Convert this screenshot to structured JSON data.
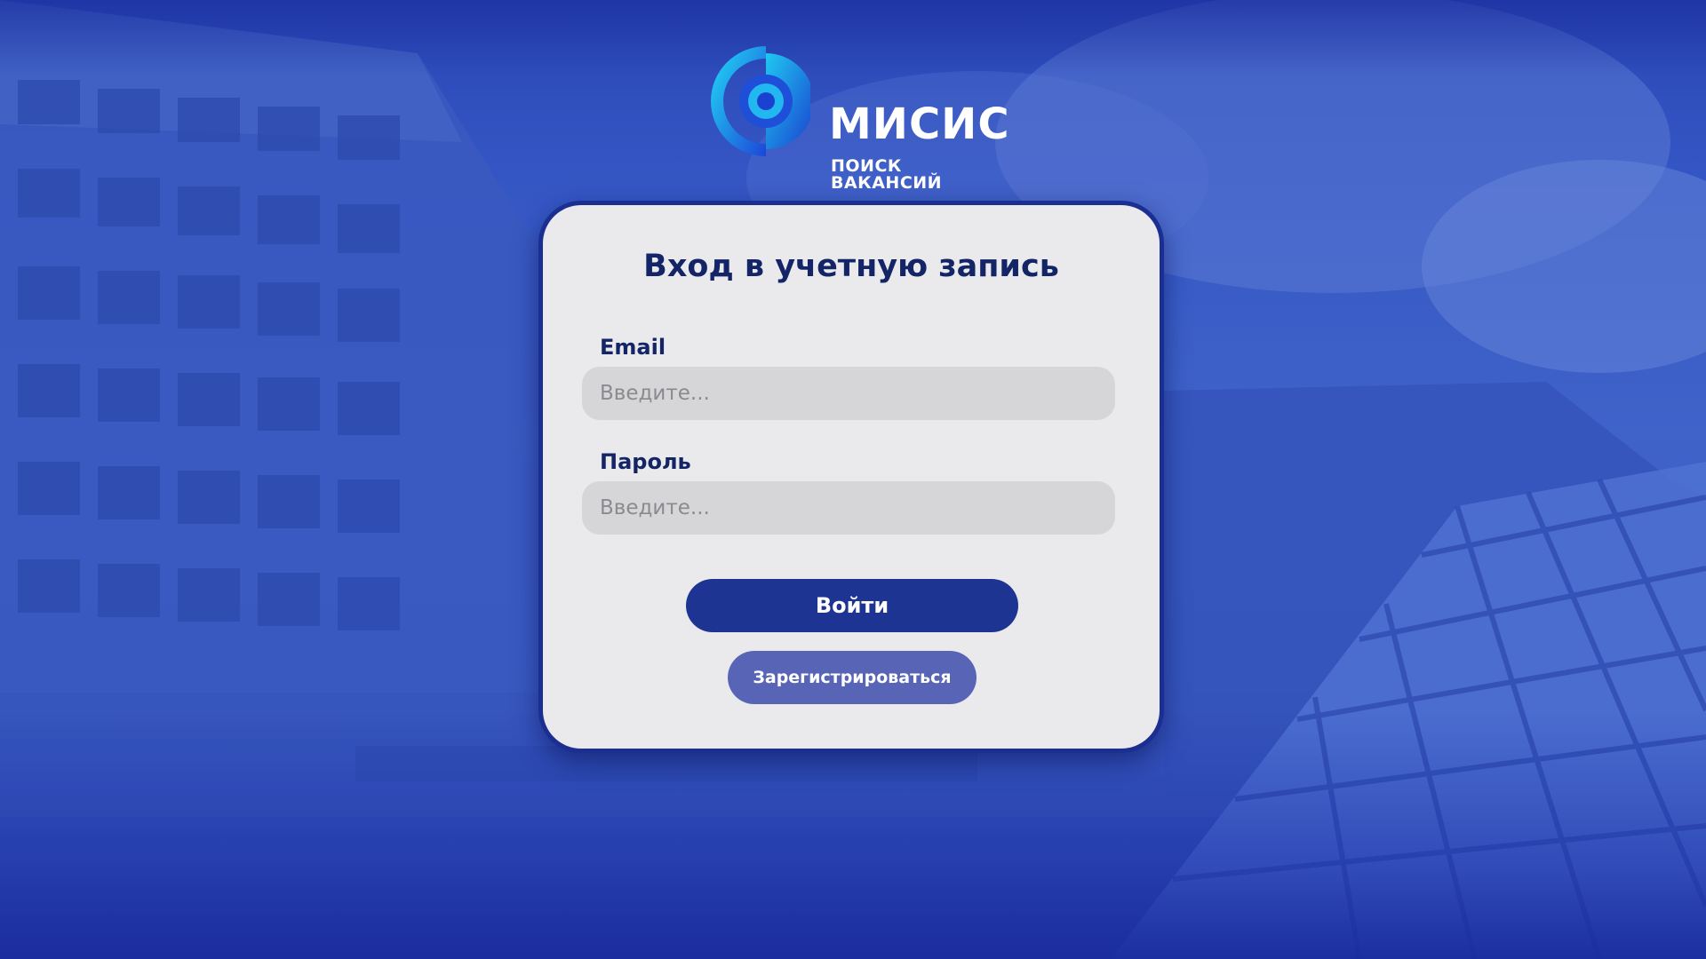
{
  "brand": {
    "name": "МИСИС",
    "tagline": "ПОИСК ВАКАНСИЙ",
    "logo_icon": "misis-logo-icon",
    "colors": {
      "logo_gradient_start": "#1ed2f5",
      "logo_gradient_end": "#1f4ad8"
    }
  },
  "login": {
    "title": "Вход в учетную запись",
    "email": {
      "label": "Email",
      "placeholder": "Введите...",
      "value": ""
    },
    "password": {
      "label": "Пароль",
      "placeholder": "Введите...",
      "value": ""
    },
    "submit_label": "Войти",
    "register_label": "Зарегистрироваться"
  },
  "theme": {
    "primary": "#1d3493",
    "secondary": "#5865b6",
    "card_background": "#eaeaec",
    "card_border": "#1b2f93",
    "input_background": "#d6d6d8",
    "heading_text": "#142567"
  }
}
